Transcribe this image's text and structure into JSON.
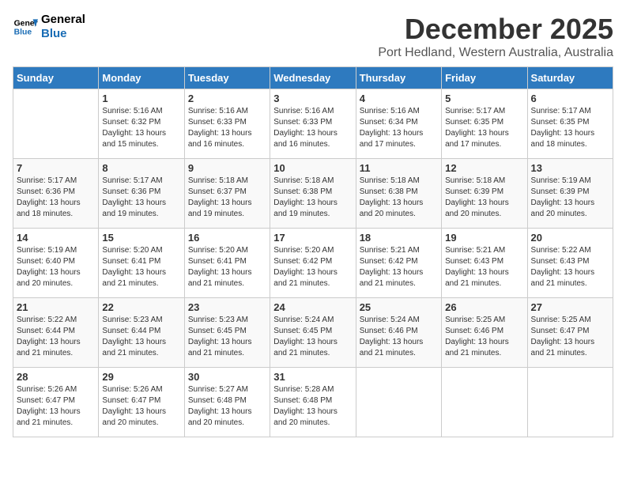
{
  "logo": {
    "line1": "General",
    "line2": "Blue"
  },
  "title": "December 2025",
  "location": "Port Hedland, Western Australia, Australia",
  "days_header": [
    "Sunday",
    "Monday",
    "Tuesday",
    "Wednesday",
    "Thursday",
    "Friday",
    "Saturday"
  ],
  "weeks": [
    [
      {
        "num": "",
        "info": ""
      },
      {
        "num": "1",
        "info": "Sunrise: 5:16 AM\nSunset: 6:32 PM\nDaylight: 13 hours\nand 15 minutes."
      },
      {
        "num": "2",
        "info": "Sunrise: 5:16 AM\nSunset: 6:33 PM\nDaylight: 13 hours\nand 16 minutes."
      },
      {
        "num": "3",
        "info": "Sunrise: 5:16 AM\nSunset: 6:33 PM\nDaylight: 13 hours\nand 16 minutes."
      },
      {
        "num": "4",
        "info": "Sunrise: 5:16 AM\nSunset: 6:34 PM\nDaylight: 13 hours\nand 17 minutes."
      },
      {
        "num": "5",
        "info": "Sunrise: 5:17 AM\nSunset: 6:35 PM\nDaylight: 13 hours\nand 17 minutes."
      },
      {
        "num": "6",
        "info": "Sunrise: 5:17 AM\nSunset: 6:35 PM\nDaylight: 13 hours\nand 18 minutes."
      }
    ],
    [
      {
        "num": "7",
        "info": "Sunrise: 5:17 AM\nSunset: 6:36 PM\nDaylight: 13 hours\nand 18 minutes."
      },
      {
        "num": "8",
        "info": "Sunrise: 5:17 AM\nSunset: 6:36 PM\nDaylight: 13 hours\nand 19 minutes."
      },
      {
        "num": "9",
        "info": "Sunrise: 5:18 AM\nSunset: 6:37 PM\nDaylight: 13 hours\nand 19 minutes."
      },
      {
        "num": "10",
        "info": "Sunrise: 5:18 AM\nSunset: 6:38 PM\nDaylight: 13 hours\nand 19 minutes."
      },
      {
        "num": "11",
        "info": "Sunrise: 5:18 AM\nSunset: 6:38 PM\nDaylight: 13 hours\nand 20 minutes."
      },
      {
        "num": "12",
        "info": "Sunrise: 5:18 AM\nSunset: 6:39 PM\nDaylight: 13 hours\nand 20 minutes."
      },
      {
        "num": "13",
        "info": "Sunrise: 5:19 AM\nSunset: 6:39 PM\nDaylight: 13 hours\nand 20 minutes."
      }
    ],
    [
      {
        "num": "14",
        "info": "Sunrise: 5:19 AM\nSunset: 6:40 PM\nDaylight: 13 hours\nand 20 minutes."
      },
      {
        "num": "15",
        "info": "Sunrise: 5:20 AM\nSunset: 6:41 PM\nDaylight: 13 hours\nand 21 minutes."
      },
      {
        "num": "16",
        "info": "Sunrise: 5:20 AM\nSunset: 6:41 PM\nDaylight: 13 hours\nand 21 minutes."
      },
      {
        "num": "17",
        "info": "Sunrise: 5:20 AM\nSunset: 6:42 PM\nDaylight: 13 hours\nand 21 minutes."
      },
      {
        "num": "18",
        "info": "Sunrise: 5:21 AM\nSunset: 6:42 PM\nDaylight: 13 hours\nand 21 minutes."
      },
      {
        "num": "19",
        "info": "Sunrise: 5:21 AM\nSunset: 6:43 PM\nDaylight: 13 hours\nand 21 minutes."
      },
      {
        "num": "20",
        "info": "Sunrise: 5:22 AM\nSunset: 6:43 PM\nDaylight: 13 hours\nand 21 minutes."
      }
    ],
    [
      {
        "num": "21",
        "info": "Sunrise: 5:22 AM\nSunset: 6:44 PM\nDaylight: 13 hours\nand 21 minutes."
      },
      {
        "num": "22",
        "info": "Sunrise: 5:23 AM\nSunset: 6:44 PM\nDaylight: 13 hours\nand 21 minutes."
      },
      {
        "num": "23",
        "info": "Sunrise: 5:23 AM\nSunset: 6:45 PM\nDaylight: 13 hours\nand 21 minutes."
      },
      {
        "num": "24",
        "info": "Sunrise: 5:24 AM\nSunset: 6:45 PM\nDaylight: 13 hours\nand 21 minutes."
      },
      {
        "num": "25",
        "info": "Sunrise: 5:24 AM\nSunset: 6:46 PM\nDaylight: 13 hours\nand 21 minutes."
      },
      {
        "num": "26",
        "info": "Sunrise: 5:25 AM\nSunset: 6:46 PM\nDaylight: 13 hours\nand 21 minutes."
      },
      {
        "num": "27",
        "info": "Sunrise: 5:25 AM\nSunset: 6:47 PM\nDaylight: 13 hours\nand 21 minutes."
      }
    ],
    [
      {
        "num": "28",
        "info": "Sunrise: 5:26 AM\nSunset: 6:47 PM\nDaylight: 13 hours\nand 21 minutes."
      },
      {
        "num": "29",
        "info": "Sunrise: 5:26 AM\nSunset: 6:47 PM\nDaylight: 13 hours\nand 20 minutes."
      },
      {
        "num": "30",
        "info": "Sunrise: 5:27 AM\nSunset: 6:48 PM\nDaylight: 13 hours\nand 20 minutes."
      },
      {
        "num": "31",
        "info": "Sunrise: 5:28 AM\nSunset: 6:48 PM\nDaylight: 13 hours\nand 20 minutes."
      },
      {
        "num": "",
        "info": ""
      },
      {
        "num": "",
        "info": ""
      },
      {
        "num": "",
        "info": ""
      }
    ]
  ]
}
